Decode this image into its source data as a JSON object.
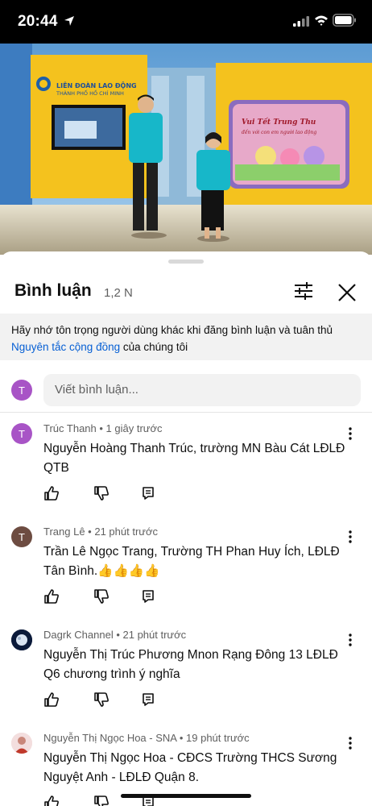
{
  "status_bar": {
    "time": "20:44"
  },
  "video": {
    "wall_logo_line1": "LIÊN ĐOÀN LAO ĐỘNG",
    "wall_logo_line2": "THÀNH PHỐ HỒ CHÍ MINH",
    "screen_title": "Vui Tết Trung Thu",
    "screen_subtitle": "đến với con em người lao động"
  },
  "comments_panel": {
    "title": "Bình luận",
    "count": "1,2 N",
    "notice_text": "Hãy nhớ tôn trọng người dùng khác khi đăng bình luận và tuân thủ",
    "notice_link": "Nguyên tắc cộng đồng",
    "notice_suffix": " của chúng tôi",
    "compose_avatar_letter": "T",
    "compose_placeholder": "Viết bình luận...",
    "colors": {
      "accent_link": "#065fd4",
      "avatar_purple": "#a854c6",
      "avatar_brown": "#6d4c41"
    }
  },
  "comments": [
    {
      "avatar_letter": "T",
      "author": "Trúc Thanh",
      "time": "1 giây trước",
      "text": "Nguyễn Hoàng Thanh Trúc, trường MN Bàu Cát LĐLĐ QTB"
    },
    {
      "avatar_letter": "T",
      "author": "Trang Lê",
      "time": "21 phút trước",
      "text": "Trần Lê Ngọc Trang, Trường TH Phan Huy Ích, LĐLĐ Tân Bình.👍👍👍👍"
    },
    {
      "avatar_letter": "",
      "author": "Dagrk Channel",
      "time": "21 phút trước",
      "text": "Nguyễn Thị Trúc Phương Mnon Rạng Đông 13 LĐLĐ Q6  chương trình ý nghĩa"
    },
    {
      "avatar_letter": "",
      "author": "Nguyễn Thị Ngọc Hoa - SNA",
      "time": "19 phút trước",
      "text": "Nguyễn Thị Ngọc Hoa - CĐCS Trường THCS Sương Nguyệt Anh - LĐLĐ Quận 8."
    }
  ]
}
